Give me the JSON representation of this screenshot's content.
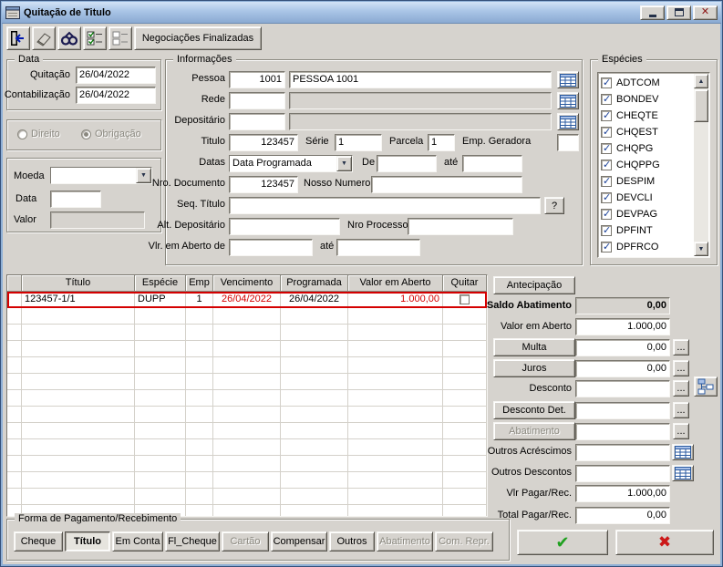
{
  "titlebar": {
    "title": "Quitação de Titulo"
  },
  "toolbar": {
    "finalizadas_label": "Negociações Finalizadas"
  },
  "left": {
    "data_group": {
      "legend": "Data",
      "quitacao_label": "Quitação",
      "quitacao_value": "26/04/2022",
      "contab_label": "Contabilização",
      "contab_value": "26/04/2022"
    },
    "tipo": {
      "direito_label": "Direito",
      "obrigacao_label": "Obrigação"
    },
    "moeda": {
      "moeda_label": "Moeda",
      "data_label": "Data",
      "valor_label": "Valor"
    }
  },
  "info": {
    "legend": "Informações",
    "pessoa_label": "Pessoa",
    "pessoa_cod": "1001",
    "pessoa_nome": "PESSOA 1001",
    "rede_label": "Rede",
    "depositario_label": "Depositário",
    "titulo_label": "Titulo",
    "titulo_value": "123457",
    "serie_label": "Série",
    "serie_value": "1",
    "parcela_label": "Parcela",
    "parcela_value": "1",
    "emp_label": "Emp. Geradora",
    "datas_label": "Datas",
    "datas_value": "Data Programada",
    "de_label": "De",
    "ate_label": "até",
    "nrodoc_label": "Nro. Documento",
    "nrodoc_value": "123457",
    "nosso_label": "Nosso Numero",
    "seq_label": "Seq. Título",
    "help_label": "?",
    "altdep_label": "Alt. Depositário",
    "nroproc_label": "Nro Processo",
    "vlraberto_label": "Vlr. em Aberto de",
    "vlrate_label": "até"
  },
  "especies": {
    "legend": "Espécies",
    "items": [
      "ADTCOM",
      "BONDEV",
      "CHEQTE",
      "CHQEST",
      "CHQPG",
      "CHQPPG",
      "DESPIM",
      "DEVCLI",
      "DEVPAG",
      "DPFINT",
      "DPFRCO"
    ]
  },
  "grid": {
    "headers": [
      "Título",
      "Espécie",
      "Emp",
      "Vencimento",
      "Programada",
      "Valor em Aberto",
      "Quitar"
    ],
    "row": {
      "titulo": "123457-1/1",
      "especie": "DUPP",
      "emp": "1",
      "vencimento": "26/04/2022",
      "programada": "26/04/2022",
      "valor_em_aberto": "1.000,00"
    }
  },
  "panel": {
    "antecipacao_label": "Antecipação",
    "saldo_label": "Saldo Abatimento",
    "saldo_value": "0,00",
    "valor_aberto_label": "Valor em Aberto",
    "valor_aberto_value": "1.000,00",
    "multa_label": "Multa",
    "multa_value": "0,00",
    "juros_label": "Juros",
    "juros_value": "0,00",
    "desconto_label": "Desconto",
    "desconto_det_label": "Desconto Det.",
    "abatimento_label": "Abatimento",
    "acrescimos_label": "Outros Acréscimos",
    "descontos_label": "Outros Descontos",
    "vlr_pagar_label": "Vlr Pagar/Rec.",
    "vlr_pagar_value": "1.000,00",
    "total_label": "Total Pagar/Rec.",
    "total_value": "0,00",
    "dots_label": "..."
  },
  "forma": {
    "legend": "Forma de Pagamento/Recebimento",
    "buttons": [
      "Cheque",
      "Título",
      "Em Conta",
      "Fl_Cheque",
      "Cartão",
      "Compensar",
      "Outros",
      "Abatimento",
      "Com. Repr."
    ]
  }
}
